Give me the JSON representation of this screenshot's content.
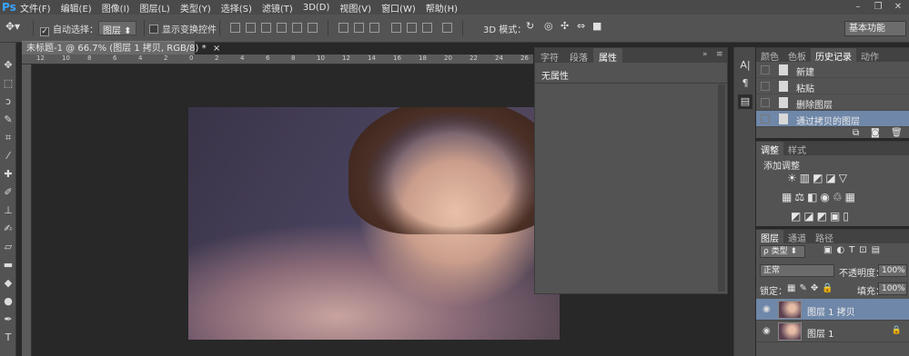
{
  "app": {
    "logo": "Ps"
  },
  "menu": [
    "文件(F)",
    "编辑(E)",
    "图像(I)",
    "图层(L)",
    "类型(Y)",
    "选择(S)",
    "滤镜(T)",
    "3D(D)",
    "视图(V)",
    "窗口(W)",
    "帮助(H)"
  ],
  "window_controls": {
    "minimize": "–",
    "restore": "❐",
    "close": "✕"
  },
  "options": {
    "auto_select_label": "自动选择：",
    "auto_select_value": "图层",
    "show_transform_label": "显示变换控件",
    "mode_3d_label": "3D 模式：",
    "workspace": "基本功能"
  },
  "document": {
    "tab_title": "未标题-1 @ 66.7% (图层 1 拷贝, RGB/8) *",
    "close": "×",
    "ruler_ticks": [
      "12",
      "10",
      "8",
      "6",
      "4",
      "2",
      "0",
      "2",
      "4",
      "6",
      "8",
      "10",
      "12",
      "14",
      "16",
      "18",
      "20",
      "22",
      "24",
      "26"
    ]
  },
  "properties_panel": {
    "tabs": [
      "字符",
      "段落",
      "属性"
    ],
    "active_tab": "属性",
    "no_properties": "无属性",
    "collapse": "»",
    "menu": "≡"
  },
  "history_panel": {
    "tabs": [
      "颜色",
      "色板",
      "历史记录",
      "动作"
    ],
    "active_tab": "历史记录",
    "items": [
      "新建",
      "粘贴",
      "删除图层",
      "通过拷贝的图层"
    ],
    "selected_index": 3
  },
  "adjustments_panel": {
    "tabs": [
      "调整",
      "样式"
    ],
    "title": "添加调整"
  },
  "layers_panel": {
    "tabs": [
      "图层",
      "通道",
      "路径"
    ],
    "kind_filter": "ρ 类型",
    "blend_mode": "正常",
    "opacity_label": "不透明度：",
    "opacity_value": "100%",
    "lock_label": "锁定：",
    "fill_label": "填充：",
    "fill_value": "100%",
    "layers": [
      {
        "name": "图层 1 拷贝",
        "selected": true,
        "locked": false
      },
      {
        "name": "图层 1",
        "selected": false,
        "locked": true
      }
    ]
  },
  "colors": {
    "accent_selection": "#6f87a8",
    "panel_bg": "#535353",
    "workspace_bg": "#282828"
  }
}
